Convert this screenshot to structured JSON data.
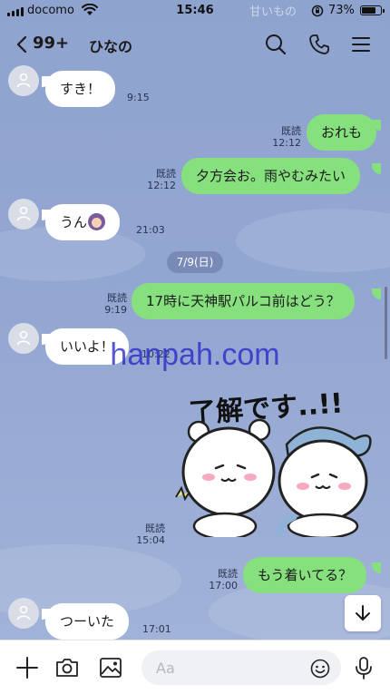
{
  "status_bar": {
    "carrier": "docomo",
    "time": "15:46",
    "battery": "73%",
    "background_notification": "甘いもの"
  },
  "header": {
    "unread_count": "99+",
    "title": "ひなの",
    "icons": [
      "back-icon",
      "search-icon",
      "phone-icon",
      "menu-icon"
    ]
  },
  "messages": [
    {
      "side": "in",
      "text": "すき！",
      "time": "9:15"
    },
    {
      "side": "out",
      "text": "おれも",
      "read": "既読",
      "time": "12:12"
    },
    {
      "side": "out",
      "text": "夕方会お。雨やむみたい",
      "read": "既読",
      "time": "12:12"
    },
    {
      "side": "in",
      "text": "うん",
      "emoji": "woman-emoji",
      "time": "21:03"
    },
    {
      "side": "date",
      "text": "7/9(日)"
    },
    {
      "side": "out",
      "text": "17時に天神駅パルコ前はどう？",
      "read": "既読",
      "time": "9:19"
    },
    {
      "side": "in",
      "text": "いいよ！",
      "time": "10:22"
    },
    {
      "side": "out-sticker",
      "sticker_text": "了解です..!!",
      "read": "既読",
      "time": "15:04"
    },
    {
      "side": "out",
      "text": "もう着いてる？",
      "read": "既読",
      "time": "17:00"
    },
    {
      "side": "in",
      "text": "つーいた",
      "time": "17:01"
    }
  ],
  "watermark": "hanpah.com",
  "input_bar": {
    "placeholder": "Aa",
    "icons": [
      "plus-icon",
      "camera-icon",
      "image-icon",
      "emoji-icon",
      "mic-icon"
    ]
  },
  "colors": {
    "chat_background": "#93a7d2",
    "outgoing_bubble": "#86e07d",
    "incoming_bubble": "#ffffff"
  }
}
